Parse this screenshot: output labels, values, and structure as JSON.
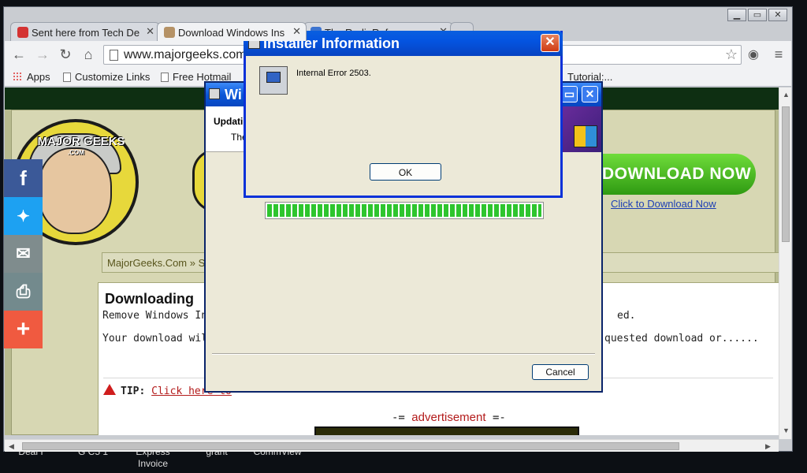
{
  "desktop": {
    "icon_labels": [
      "Deal I",
      "G C5 1",
      "Express\nInvoice",
      "grant",
      "CommView"
    ]
  },
  "browser": {
    "tabs": [
      {
        "label": "Sent here from Tech De",
        "fav_color": "#d43333"
      },
      {
        "label": "Download Windows Ins",
        "fav_color": "#b59266"
      },
      {
        "label": "The RadioReference.co",
        "fav_color": "#3c74d0"
      }
    ],
    "url": "www.majorgeeks.com",
    "bookmarks": [
      "Apps",
      "Customize Links",
      "Free Hotmail",
      "Tutorial:..."
    ]
  },
  "page": {
    "logo_text": "MAJOR GEEKS",
    "logo_sub": ".COM",
    "download_now": "DOWNLOAD NOW",
    "click_to_download": "Click to Download Now",
    "breadcrumb": "MajorGeeks.Com » S",
    "heading": "Downloading",
    "line1_left": "Remove Windows Ins",
    "line1_right": "ed.",
    "line2_left": "Your download will a",
    "line2_right": "quested download or......",
    "tip_label": "TIP:",
    "tip_link": "Click here to",
    "advert_left": "-=",
    "advert_word": "advertisement",
    "advert_right": "=-"
  },
  "social": [
    {
      "name": "facebook",
      "glyph": "f",
      "color": "#3b5998"
    },
    {
      "name": "twitter",
      "glyph": "🐦",
      "color": "#1da1f2"
    },
    {
      "name": "email",
      "glyph": "✉",
      "color": "#7f8c8d"
    },
    {
      "name": "print",
      "glyph": "⎙",
      "color": "#738a8d"
    },
    {
      "name": "more",
      "glyph": "+",
      "color": "#f05a40"
    }
  ],
  "installer": {
    "title": "Wi",
    "heading": "Updatin",
    "subtext": "The",
    "progress": 1.0,
    "cancel_label": "Cancel"
  },
  "dialog": {
    "title": "Installer Information",
    "message": "Internal Error 2503.",
    "ok_label": "OK",
    "close_glyph": "✕"
  }
}
